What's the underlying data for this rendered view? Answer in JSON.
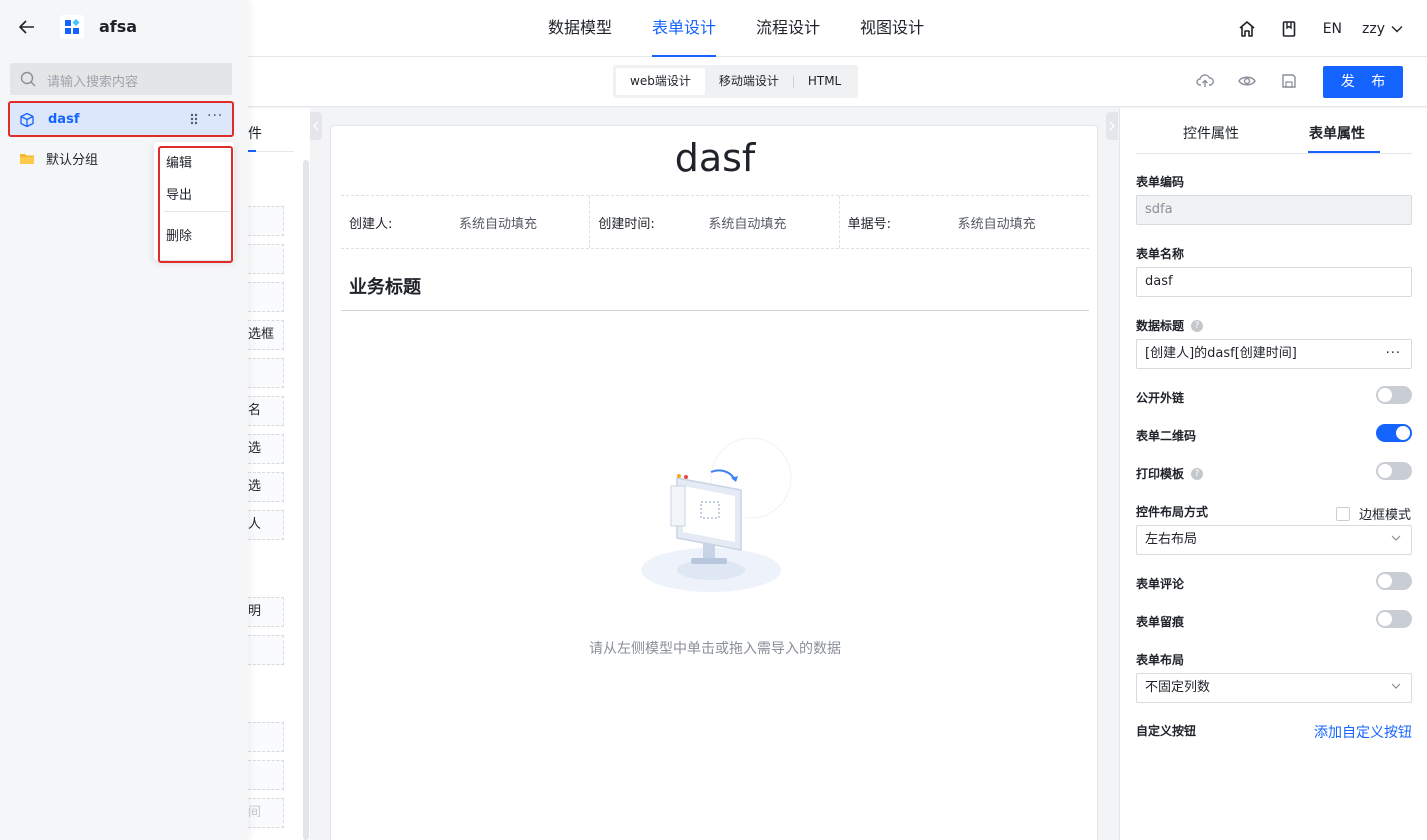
{
  "top_nav": {
    "tabs": [
      {
        "label": "数据模型",
        "active": false
      },
      {
        "label": "表单设计",
        "active": true
      },
      {
        "label": "流程设计",
        "active": false
      },
      {
        "label": "视图设计",
        "active": false
      }
    ],
    "lang": "EN",
    "user": "zzy"
  },
  "toolbar": {
    "modes": [
      {
        "label": "web端设计",
        "active": true
      },
      {
        "label": "移动端设计",
        "active": false
      },
      {
        "label": "HTML",
        "active": false
      }
    ],
    "publish": "发 布"
  },
  "drawer": {
    "app_name": "afsa",
    "search_placeholder": "请输入搜索内容",
    "selected_item": "dasf",
    "group_item": "默认分组"
  },
  "context_menu": {
    "items": [
      "编辑",
      "导出",
      "删除"
    ]
  },
  "component_panel": {
    "tab_fragment": "件",
    "item_fragments": [
      "",
      "",
      "",
      "选框",
      "",
      "名",
      "选",
      "选",
      "人",
      "明",
      "",
      "",
      "",
      "间"
    ]
  },
  "canvas": {
    "title": "dasf",
    "meta": [
      {
        "label": "创建人:",
        "value": "系统自动填充"
      },
      {
        "label": "创建时间:",
        "value": "系统自动填充"
      },
      {
        "label": "单据号:",
        "value": "系统自动填充"
      }
    ],
    "business_title": "业务标题",
    "empty_hint": "请从左侧模型中单击或拖入需导入的数据"
  },
  "props": {
    "tabs": [
      {
        "label": "控件属性",
        "active": false
      },
      {
        "label": "表单属性",
        "active": true
      }
    ],
    "form_code_label": "表单编码",
    "form_code_value": "sdfa",
    "form_name_label": "表单名称",
    "form_name_value": "dasf",
    "data_title_label": "数据标题",
    "data_title_value": "[创建人]的dasf[创建时间]",
    "public_link_label": "公开外链",
    "public_link_on": false,
    "qr_label": "表单二维码",
    "qr_on": true,
    "print_label": "打印模板",
    "print_on": false,
    "layout_label": "控件布局方式",
    "border_mode_label": "边框模式",
    "layout_value": "左右布局",
    "comment_label": "表单评论",
    "comment_on": false,
    "trace_label": "表单留痕",
    "trace_on": false,
    "form_layout_label": "表单布局",
    "form_layout_value": "不固定列数",
    "custom_btn_label": "自定义按钮",
    "custom_btn_link": "添加自定义按钮"
  },
  "colors": {
    "accent": "#1664ff",
    "highlight_outline": "#e02b2b"
  }
}
